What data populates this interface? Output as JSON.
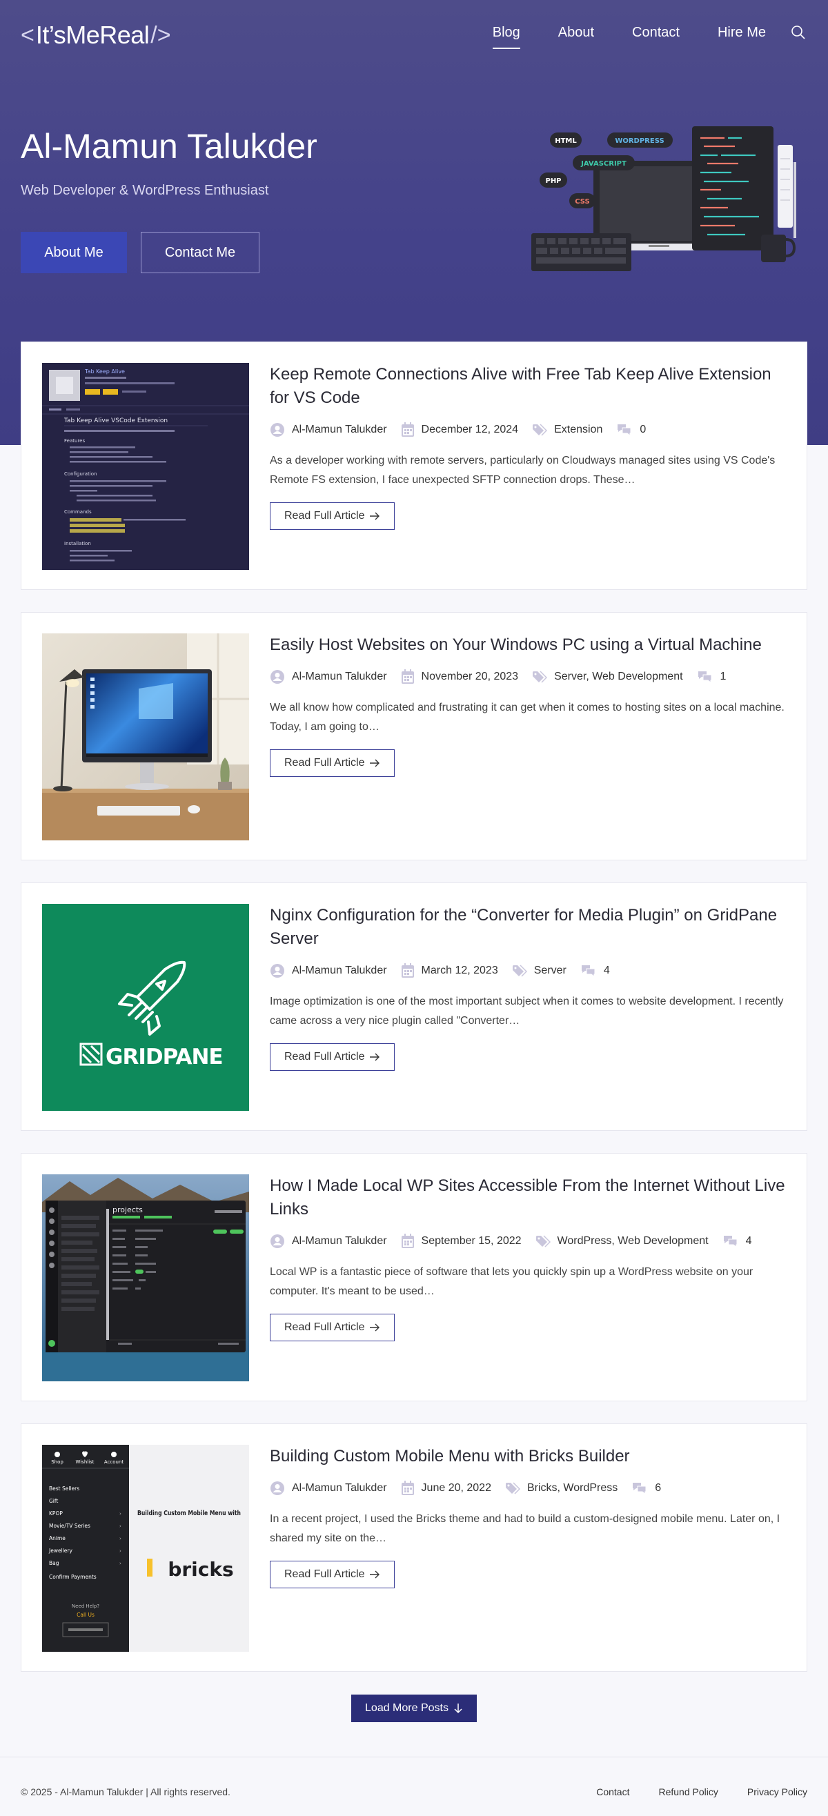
{
  "header": {
    "logo_text": "It’sMeReal",
    "logo_left": "<",
    "logo_right": "/>",
    "nav": [
      "Blog",
      "About",
      "Contact",
      "Hire Me"
    ]
  },
  "hero": {
    "title": "Al-Mamun Talukder",
    "subtitle": "Web Developer & WordPress Enthusiast",
    "btn_about": "About Me",
    "btn_contact": "Contact Me",
    "badges": [
      "HTML",
      "WORDPRESS",
      "JAVASCRIPT",
      "PHP",
      "CSS"
    ]
  },
  "posts": [
    {
      "title": "Keep Remote Connections Alive with Free Tab Keep Alive Extension for VS Code",
      "author": "Al-Mamun Talukder",
      "date": "December 12, 2024",
      "category": "Extension",
      "comments": "0",
      "excerpt": "As a developer working with remote servers, particularly on Cloudways managed sites using VS Code's Remote FS extension, I face unexpected SFTP connection drops. These…",
      "read": "Read Full Article"
    },
    {
      "title": "Easily Host Websites on Your Windows PC using a Virtual Machine",
      "author": "Al-Mamun Talukder",
      "date": "November 20, 2023",
      "category": "Server, Web Development",
      "comments": "1",
      "excerpt": "We all know how complicated and frustrating it can get when it comes to hosting sites on a local machine. Today, I am going to…",
      "read": "Read Full Article"
    },
    {
      "title": "Nginx Configuration for the “Converter for Media Plugin” on GridPane Server",
      "author": "Al-Mamun Talukder",
      "date": "March 12, 2023",
      "category": "Server",
      "comments": "4",
      "excerpt": "Image optimization is one of the most important subject when it comes to website development. I recently came across a very nice plugin called \"Converter…",
      "read": "Read Full Article"
    },
    {
      "title": "How I Made Local WP Sites Accessible From the Internet Without Live Links",
      "author": "Al-Mamun Talukder",
      "date": "September 15, 2022",
      "category": "WordPress, Web Development",
      "comments": "4",
      "excerpt": "Local WP is a fantastic piece of software that lets you quickly spin up a WordPress website on your computer. It's meant to be used…",
      "read": "Read Full Article"
    },
    {
      "title": "Building Custom Mobile Menu with Bricks Builder",
      "author": "Al-Mamun Talukder",
      "date": "June 20, 2022",
      "category": "Bricks, WordPress",
      "comments": "6",
      "excerpt": "In a recent project, I used the Bricks theme and had to build a custom-designed mobile menu. Later on, I shared my site on the…",
      "read": "Read Full Article"
    }
  ],
  "thumbs": {
    "vscode": {
      "name": "Tab Keep Alive",
      "heading": "Tab Keep Alive VSCode Extension",
      "sections": [
        "Features",
        "Configuration",
        "Commands",
        "Installation"
      ]
    },
    "gridpane": {
      "brand": "GRIDPANE"
    },
    "localwp": {
      "title": "projects"
    },
    "bricks": {
      "tabs": [
        "Shop",
        "Wishlist",
        "Account"
      ],
      "menu": [
        "Best Sellers",
        "Gift",
        "KPOP",
        "Movie/TV Series",
        "Anime",
        "Jewellery",
        "Bag",
        "Confirm Payments"
      ],
      "help": "Need Help?",
      "call": "Call Us",
      "headline": "Building Custom Mobile Menu with",
      "brand": "bricks"
    }
  },
  "load_more": "Load More Posts",
  "footer": {
    "copyright": "© 2025 - Al-Mamun Talukder | All rights reserved.",
    "links": [
      "Contact",
      "Refund Policy",
      "Privacy Policy"
    ]
  },
  "colors": {
    "hero_bg": "#46448a",
    "primary": "#3b47b5",
    "load_more": "#2b2d78",
    "meta_icon": "#c9c6dc",
    "gridpane_green": "#0e8a5b"
  }
}
